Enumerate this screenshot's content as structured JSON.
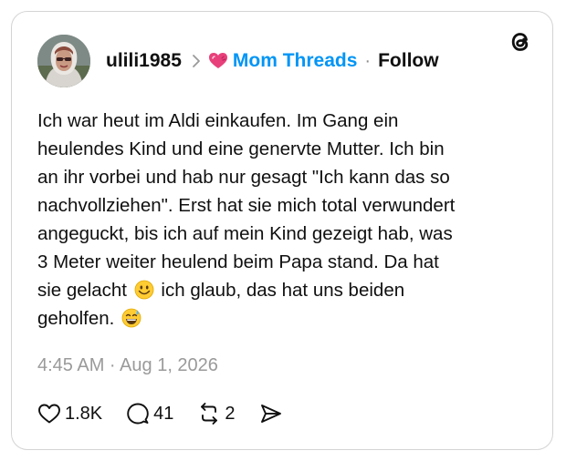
{
  "post": {
    "author": {
      "username": "ulili1985"
    },
    "community": {
      "name": "Mom Threads"
    },
    "separator": "·",
    "follow_label": "Follow",
    "text_lines": [
      "Ich war heut im Aldi einkaufen. Im Gang ein",
      "heulendes Kind und eine genervte Mutter. Ich bin",
      "an ihr vorbei und hab nur gesagt \"Ich kann das so",
      "nachvollziehen\". Erst hat sie mich total verwundert",
      "angeguckt, bis ich auf mein Kind gezeigt hab, was",
      "3 Meter weiter heulend beim Papa stand. Da hat",
      "sie gelacht",
      "ich glaub, das hat uns beiden",
      "geholfen."
    ],
    "timestamp": "4:45 AM · Aug 1, 2026",
    "stats": {
      "likes": "1.8K",
      "replies": "41",
      "reposts": "2"
    }
  },
  "icons": {
    "chevron": "chevron-right-icon",
    "community": "heart-icon",
    "logo": "threads-logo-icon",
    "like": "heart-outline-icon",
    "reply": "speech-bubble-icon",
    "repost": "repost-arrows-icon",
    "share": "send-icon",
    "emoji_1": "smiley-emoji",
    "emoji_2": "grinning-sweat-emoji"
  },
  "colors": {
    "accent": "#0095f6",
    "text": "#101010",
    "muted": "#9a9a9a",
    "heart_pink": "#e8407a"
  }
}
